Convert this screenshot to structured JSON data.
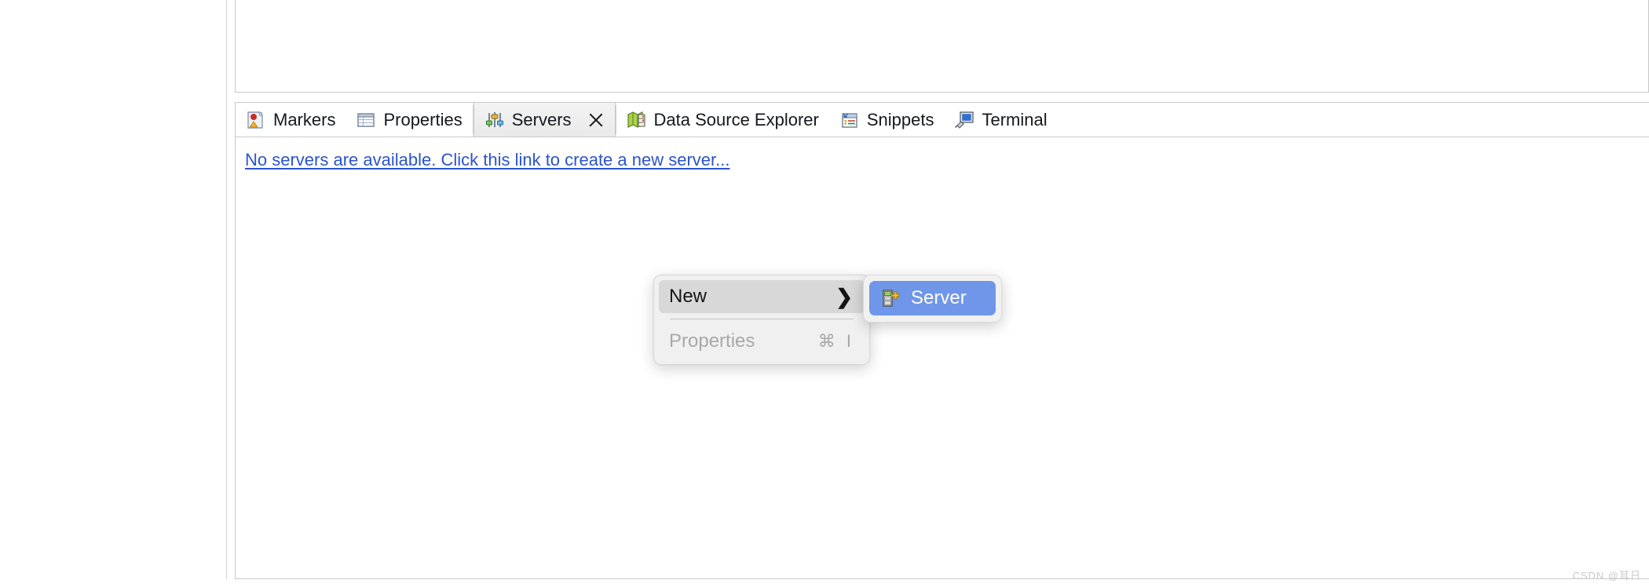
{
  "workbench": {
    "left_pane_name": "editor-area-empty",
    "upper_pane_name": "editor-area-upper"
  },
  "tabbar": {
    "tabs": [
      {
        "label": "Markers",
        "icon": "markers-icon",
        "active": false,
        "closable": false
      },
      {
        "label": "Properties",
        "icon": "properties-icon",
        "active": false,
        "closable": false
      },
      {
        "label": "Servers",
        "icon": "servers-icon",
        "active": true,
        "closable": true
      },
      {
        "label": "Data Source Explorer",
        "icon": "data-source-explorer-icon",
        "active": false,
        "closable": false
      },
      {
        "label": "Snippets",
        "icon": "snippets-icon",
        "active": false,
        "closable": false
      },
      {
        "label": "Terminal",
        "icon": "terminal-icon",
        "active": false,
        "closable": false
      }
    ],
    "close_icon": "close-icon"
  },
  "servers_view": {
    "empty_link_text": "No servers are available. Click this link to create a new server..."
  },
  "context_menu": {
    "items": [
      {
        "label": "New",
        "shortcut": "",
        "submenu": true,
        "disabled": false,
        "highlighted": true
      },
      {
        "label": "Properties",
        "shortcut": "⌘ I",
        "submenu": false,
        "disabled": true,
        "highlighted": false
      }
    ],
    "submenu_arrow": "❯"
  },
  "submenu": {
    "items": [
      {
        "label": "Server",
        "icon": "new-server-icon",
        "selected": true
      }
    ]
  },
  "colors": {
    "link": "#2b54c9",
    "selection_blue": "#6f96e8",
    "menu_bg": "#f0f0f0",
    "highlight_grey": "#d8d8d8",
    "disabled_text": "#a8a8a8",
    "border": "#c8c8c8"
  },
  "watermark": {
    "text": "CSDN @耳日"
  }
}
